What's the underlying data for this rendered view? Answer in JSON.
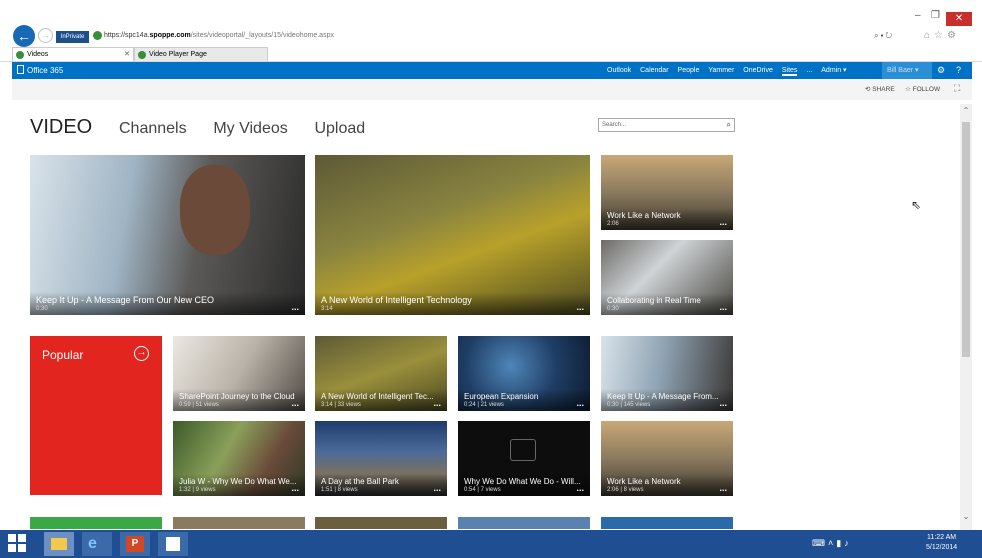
{
  "browser": {
    "url_prefix": "https://spc14a.",
    "url_domain": "spoppe.com",
    "url_path": "/sites/videoportal/_layouts/15/videohome.aspx",
    "inprivate": "InPrivate",
    "tabs": [
      {
        "label": "Videos",
        "active": true
      },
      {
        "label": "Video Player Page",
        "active": false
      }
    ]
  },
  "suitebar": {
    "brand": "Office 365",
    "links": [
      "Outlook",
      "Calendar",
      "People",
      "Yammer",
      "OneDrive",
      "Sites",
      "...",
      "Admin ▾"
    ],
    "active_link": "Sites",
    "user": "Bill Baer"
  },
  "ribbon": {
    "share": "SHARE",
    "follow": "FOLLOW"
  },
  "nav": {
    "title": "VIDEO",
    "links": [
      "Channels",
      "My Videos",
      "Upload"
    ],
    "search_placeholder": "Search..."
  },
  "featured": [
    {
      "title": "Keep It Up - A Message From Our New CEO",
      "meta": "0:30"
    },
    {
      "title": "A New World of Intelligent Technology",
      "meta": "3:14"
    },
    {
      "title": "Work Like a Network",
      "meta": "2:06"
    },
    {
      "title": "Collaborating in Real Time",
      "meta": "0:30"
    }
  ],
  "popular": {
    "label": "Popular",
    "videos": [
      {
        "title": "SharePoint Journey to the Cloud",
        "meta": "0:59 | 51 views"
      },
      {
        "title": "A New World of Intelligent Tec...",
        "meta": "3:14 | 33 views"
      },
      {
        "title": "European Expansion",
        "meta": "0:24 | 21 views"
      },
      {
        "title": "Keep It Up - A Message From...",
        "meta": "0:30 | 145 views"
      },
      {
        "title": "Julia W - Why We Do What We...",
        "meta": "1:32 | 9 views"
      },
      {
        "title": "A Day at the Ball Park",
        "meta": "1:51 | 8 views"
      },
      {
        "title": "Why We Do What We Do - Will...",
        "meta": "0:54 | 7 views"
      },
      {
        "title": "Work Like a Network",
        "meta": "2:06 | 8 views"
      }
    ]
  },
  "more_dots": "...",
  "taskbar": {
    "time": "11:22 AM",
    "date": "5/12/2014"
  },
  "colors": {
    "suite_blue": "#0072c6",
    "popular_red": "#e3251f",
    "taskbar": "#1f4e93"
  }
}
